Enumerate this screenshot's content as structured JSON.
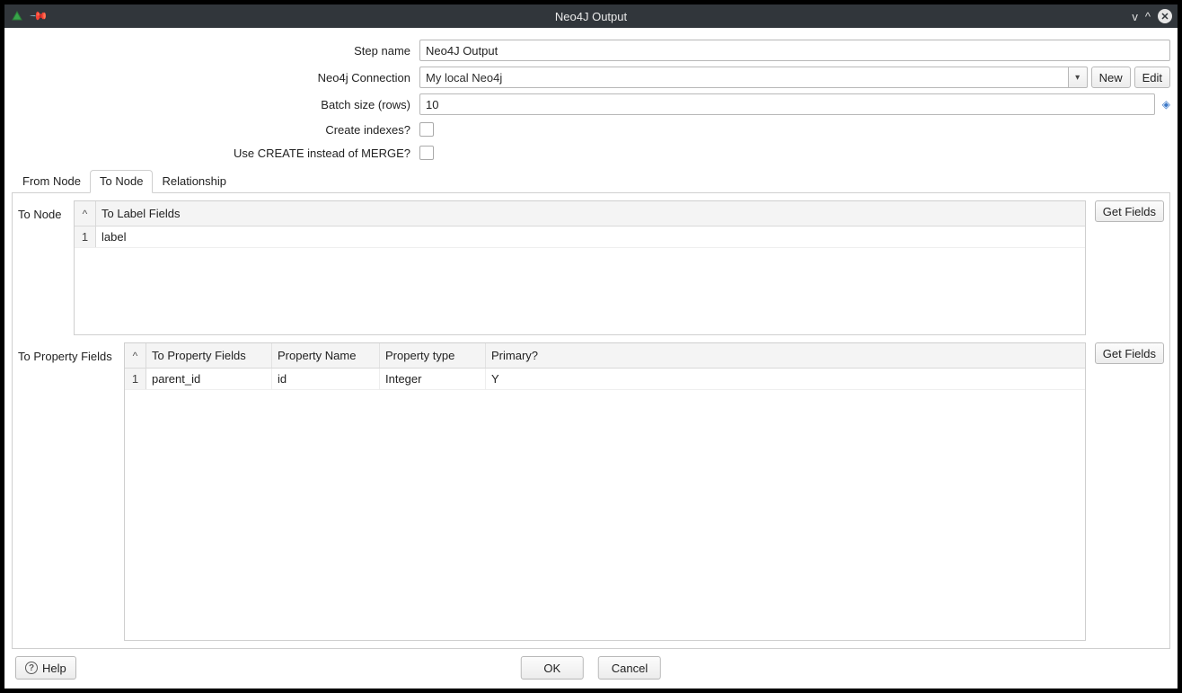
{
  "window": {
    "title": "Neo4J Output"
  },
  "form": {
    "step_name_label": "Step name",
    "step_name_value": "Neo4J Output",
    "connection_label": "Neo4j Connection",
    "connection_value": "My local Neo4j",
    "new_button": "New",
    "edit_button": "Edit",
    "batch_size_label": "Batch size (rows)",
    "batch_size_value": "10",
    "create_indexes_label": "Create indexes?",
    "use_create_label": "Use CREATE instead of MERGE?"
  },
  "tabs": {
    "from_node": "From Node",
    "to_node": "To Node",
    "relationship": "Relationship"
  },
  "to_node_section": {
    "label": "To Node",
    "get_fields": "Get Fields",
    "columns": {
      "sort_hat": "^",
      "label_fields": "To Label Fields"
    },
    "rows": [
      {
        "n": "1",
        "label_field": "label"
      }
    ]
  },
  "to_property_section": {
    "label": "To Property Fields",
    "get_fields": "Get Fields",
    "columns": {
      "sort_hat": "^",
      "fields": "To Property Fields",
      "name": "Property Name",
      "type": "Property type",
      "primary": "Primary?"
    },
    "rows": [
      {
        "n": "1",
        "field": "parent_id",
        "name": "id",
        "type": "Integer",
        "primary": "Y"
      }
    ]
  },
  "footer": {
    "help": "Help",
    "ok": "OK",
    "cancel": "Cancel"
  }
}
